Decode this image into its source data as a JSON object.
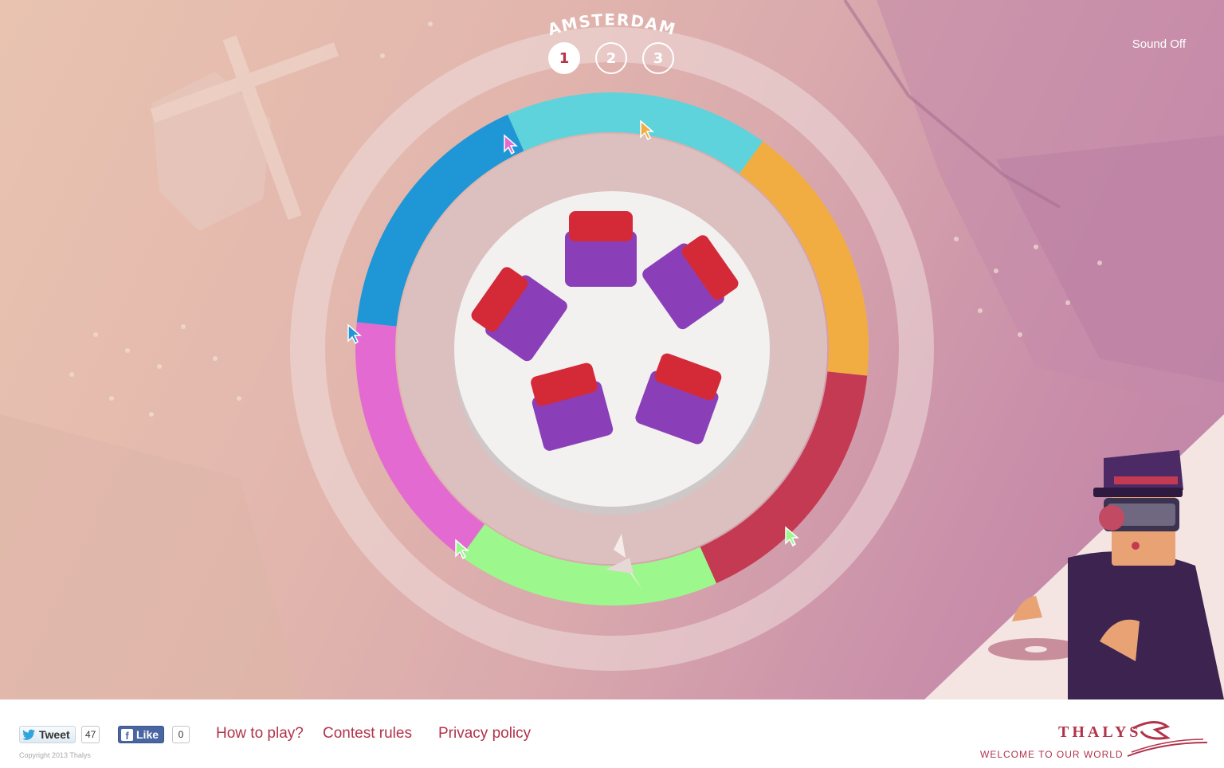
{
  "game": {
    "city_title": "AMSTERDAM",
    "levels": [
      {
        "label": "1",
        "active": true
      },
      {
        "label": "2",
        "active": false
      },
      {
        "label": "3",
        "active": false
      }
    ],
    "sound_toggle": "Sound Off",
    "ring_segments": [
      {
        "name": "cyan",
        "color": "#5ed3dc"
      },
      {
        "name": "orange",
        "color": "#f2ad42"
      },
      {
        "name": "red",
        "color": "#c43a53"
      },
      {
        "name": "green",
        "color": "#9cf88c"
      },
      {
        "name": "magenta",
        "color": "#e36ad0"
      },
      {
        "name": "blue",
        "color": "#1f97d7"
      }
    ],
    "seat_colors": {
      "back": "#d42a38",
      "base": "#8a3fb8"
    }
  },
  "footer": {
    "tweet_label": "Tweet",
    "tweet_count": "47",
    "like_label": "Like",
    "like_count": "0",
    "copyright": "Copyright 2013 Thalys",
    "links": {
      "how_to_play": "How to play?",
      "contest_rules": "Contest rules",
      "privacy_policy": "Privacy policy"
    },
    "brand_name": "THALYS",
    "brand_tagline": "WELCOME TO OUR WORLD"
  },
  "colors": {
    "accent": "#b2334a"
  }
}
